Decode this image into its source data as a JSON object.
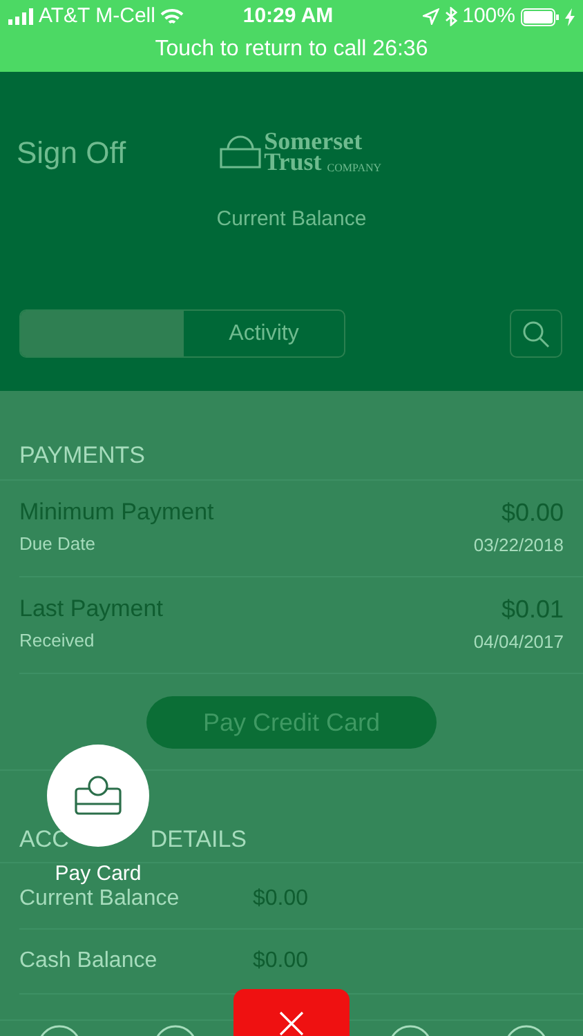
{
  "status_bar": {
    "carrier": "AT&T M-Cell",
    "time": "10:29 AM",
    "battery": "100%"
  },
  "call_banner": {
    "text": "Touch to return to call 26:36"
  },
  "header": {
    "sign_off": "Sign Off",
    "logo": {
      "line_1": "Somerset",
      "line_2": "Trust",
      "line_3": "COMPANY"
    },
    "balance_label": "Current Balance"
  },
  "tabs": [
    {
      "selected": true
    },
    {
      "label": "Activity",
      "selected": false
    }
  ],
  "payments": {
    "heading": "PAYMENTS",
    "rows": [
      {
        "title": "Minimum Payment",
        "subtitle": "Due Date",
        "amount": "$0.00",
        "date": "03/22/2018"
      },
      {
        "title": "Last Payment",
        "subtitle": "Received",
        "amount": "$0.01",
        "date": "04/04/2017"
      }
    ],
    "button": "Pay Credit Card"
  },
  "account_details": {
    "heading_parts": [
      "ACC",
      "DETAILS"
    ],
    "rows": [
      {
        "label": "Current Balance",
        "value": "$0.00"
      },
      {
        "label": "Cash Balance",
        "value": "$0.00"
      }
    ]
  },
  "fab_menu": {
    "action": {
      "label": "Pay Card"
    }
  },
  "bottom_tabs": [
    {
      "kind": "tab"
    },
    {
      "kind": "tab"
    },
    {
      "kind": "close"
    },
    {
      "kind": "tab"
    },
    {
      "kind": "tab"
    }
  ]
}
